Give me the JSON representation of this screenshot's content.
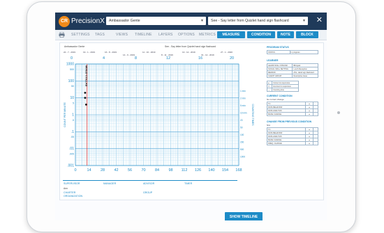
{
  "app": {
    "name": "PrecisionX",
    "logo_text": "CR",
    "close_glyph": "✕"
  },
  "selectors": {
    "learner": "Ambassador Gente",
    "pinpoint": "See - Say letter from Quizlet hand sign flashcard"
  },
  "nav": {
    "items": [
      "SETTINGS",
      "TAGS",
      "VIEWS",
      "TIMELINE",
      "LAYERS",
      "OPTIONS",
      "METRICS"
    ],
    "buttons": [
      "MEASURE",
      "CONDITION",
      "NOTE",
      "BLOCK"
    ]
  },
  "chart_header": {
    "learner_name": "Ambassador Gente",
    "pinpoint_text": "See - Say letter from Quizlet hand sign flashcard",
    "dates": [
      "22 - 7 - 2019",
      "19 - 1 - 2019",
      "16 - 8 - 2019",
      "14 - 9 - 2019",
      "11 - 10 - 2019",
      "8 - 11 - 2019",
      "13 - 12 - 2019",
      "31 - 12 - 2019",
      "27 - 1 - 2020"
    ],
    "week_marks": [
      "0",
      "4",
      "8",
      "12",
      "16",
      "20"
    ]
  },
  "axis": {
    "left_label": "COUNT PER MINUTE",
    "right_label": "COUNTING TIMES",
    "y_ticks": [
      "1000",
      "500",
      "100",
      "50",
      "10",
      "5",
      "1",
      ".5",
      ".1",
      ".05",
      ".01",
      ".005",
      ".001"
    ],
    "x_ticks": [
      "0",
      "14",
      "28",
      "42",
      "56",
      "70",
      "84",
      "98",
      "112",
      "126",
      "140",
      "154",
      "168"
    ],
    "right_ticks": [
      "1 min",
      "2 min",
      "5 min",
      "10 min",
      "20",
      "50",
      "100",
      "200",
      "500",
      "1000"
    ]
  },
  "chart_data": {
    "type": "scatter",
    "x_label": "",
    "y_scale": "log",
    "ylim": [
      0.001,
      1000
    ],
    "xlim": [
      0,
      168
    ],
    "series": [
      {
        "values": [
          {
            "x": 10,
            "y": 20
          },
          {
            "x": 10,
            "y": 10
          },
          {
            "x": 11,
            "y": 4
          }
        ]
      }
    ],
    "phase_line_x": 12,
    "annotation": "MIXED COLLAB"
  },
  "footer_fields": [
    {
      "label": "SUPERVISOR",
      "value": ""
    },
    {
      "label": "MANAGER",
      "value": ""
    },
    {
      "label": "ADVISOR",
      "value": ""
    },
    {
      "label": "TIMER",
      "value": ""
    },
    {
      "label": "CHARTER",
      "value": "Ann"
    },
    {
      "label": "ORGANIZATION",
      "value": ""
    },
    {
      "label": "GROUP",
      "value": ""
    }
  ],
  "side_panel": {
    "program_status": {
      "title": "PROGRAM STATUS",
      "rows": [
        [
          "STATUS",
          "In progress"
        ]
      ]
    },
    "learner": {
      "title": "LEARNER",
      "rows": [
        [
          "LEARN SKILL STRAND",
          "Bilingual"
        ],
        [
          "SOCIAL SKILL SETTING",
          "Lunch Reception"
        ],
        [
          "MEDIUM",
          "ASL, Hand sign flashcard"
        ],
        [
          "CLIENT GROUP",
          "Descriptive Issue"
        ]
      ],
      "legend": [
        "Correct & responsive",
        "Incorrect & responsive",
        "Counting time"
      ]
    },
    "current_condition": {
      "title": "CURRENT CONDITION",
      "subtitle": "No current change",
      "rows": [
        [
          "TC",
          "●"
        ],
        [
          "DATA BEHAVIOR",
          "●"
        ],
        [
          "DATA ANALYSIS",
          "●"
        ],
        [
          "MAKE CHANGE",
          "●"
        ]
      ]
    },
    "change_from_previous": {
      "title": "CHANGE FROM PREVIOUS CONDITION",
      "subtitle": "N/A",
      "rows": [
        [
          "TC",
          "●"
        ],
        [
          "DATA BEHAVIOR",
          "●"
        ],
        [
          "DATA ANALYSIS",
          "●"
        ],
        [
          "MAKE CHANGE",
          "●"
        ],
        [
          "FREQ. CHANGE",
          "●"
        ]
      ]
    }
  },
  "bottom_button": "SHOW TIMELINE",
  "colors": {
    "topbar": "#1f3a5a",
    "accent": "#1d8bc7",
    "grid": "#bfe0f2",
    "logo": "#f08a1a",
    "phase_line": "#e33a3a"
  }
}
